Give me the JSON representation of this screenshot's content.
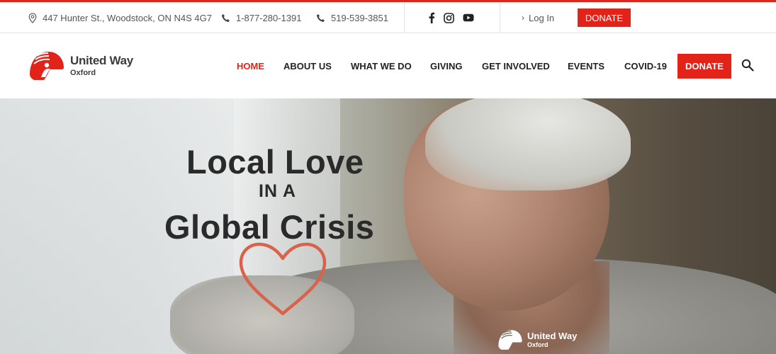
{
  "topbar": {
    "address": "447 Hunter St., Woodstock, ON N4S 4G7",
    "phone1": "1-877-280-1391",
    "phone2": "519-539-3851",
    "login": "Log In",
    "donate": "DONATE",
    "social": [
      {
        "icon": "facebook-icon"
      },
      {
        "icon": "instagram-icon"
      },
      {
        "icon": "youtube-icon"
      }
    ]
  },
  "logo": {
    "name": "United Way",
    "sub": "Oxford"
  },
  "nav": {
    "items": [
      {
        "label": "HOME",
        "active": true
      },
      {
        "label": "ABOUT US"
      },
      {
        "label": "WHAT WE DO"
      },
      {
        "label": "GIVING"
      },
      {
        "label": "GET INVOLVED"
      },
      {
        "label": "EVENTS"
      },
      {
        "label": "COVID-19"
      }
    ],
    "donate": "DONATE"
  },
  "hero": {
    "line1": "Local Love",
    "line2": "IN A",
    "line3": "Global Crisis",
    "watermark_name": "United Way",
    "watermark_sub": "Oxford"
  },
  "colors": {
    "brand_red": "#e2231a",
    "heart": "#d9634a",
    "text_dark": "#2a2a2a"
  }
}
